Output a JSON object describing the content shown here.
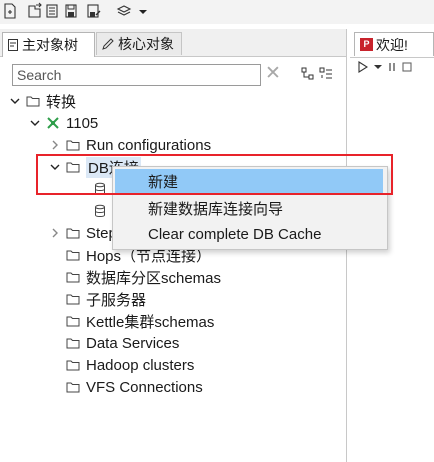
{
  "toolbar": {
    "icons": [
      "new-file-icon",
      "open-file-icon",
      "file-properties-icon",
      "save-icon",
      "save-as-icon",
      "layers-icon",
      "dropdown-arrow-icon"
    ]
  },
  "left_panel": {
    "tabs": [
      {
        "label": "主对象树",
        "icon": "tree-tab-icon",
        "active": true
      },
      {
        "label": "核心对象",
        "icon": "pencil-icon",
        "active": false
      }
    ],
    "search": {
      "placeholder": "Search",
      "value": "",
      "clear_glyph": "✕"
    },
    "tree": {
      "root": "转换",
      "transformation": "1105",
      "items": {
        "run_configurations": "Run configurations",
        "db_connections": "DB连接",
        "steps": "Steps",
        "hops": "Hops（节点连接）",
        "partition_schemas": "数据库分区schemas",
        "slave_servers": "子服务器",
        "kettle_cluster": "Kettle集群schemas",
        "data_services": "Data Services",
        "hadoop_clusters": "Hadoop clusters",
        "vfs_connections": "VFS Connections"
      }
    }
  },
  "context_menu": {
    "items": [
      "新建",
      "新建数据库连接向导",
      "Clear complete DB Cache"
    ],
    "highlighted_index": 0
  },
  "right_panel": {
    "tab_label": "欢迎!",
    "tab_icon_text": "P"
  },
  "colors": {
    "highlight_box": "#e8232a",
    "menu_highlight": "#91c9f7",
    "transform_icon": "#2e9e4a",
    "folder": "#444444",
    "selection_bg": "#dbe8f6"
  }
}
